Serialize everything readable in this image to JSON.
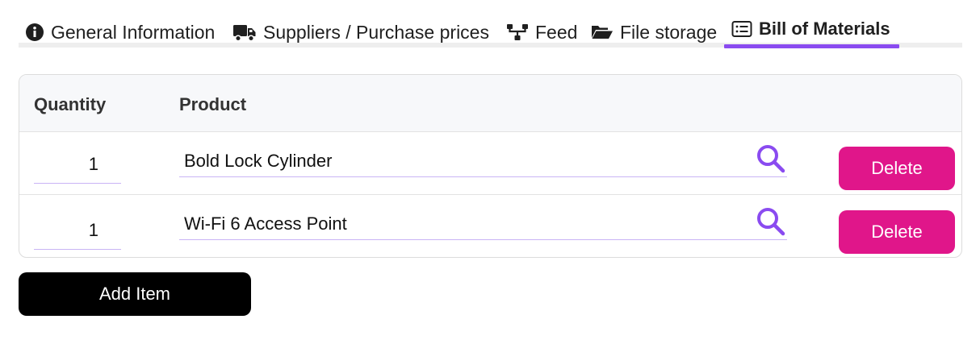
{
  "tabs": [
    {
      "label": "General Information",
      "icon": "info-circle-icon"
    },
    {
      "label": "Suppliers / Purchase prices",
      "icon": "truck-icon"
    },
    {
      "label": "Feed",
      "icon": "feed-nodes-icon"
    },
    {
      "label": "File storage",
      "icon": "folder-open-icon"
    },
    {
      "label": "Bill of Materials",
      "icon": "list-card-icon",
      "active": true
    }
  ],
  "table": {
    "headers": {
      "quantity": "Quantity",
      "product": "Product"
    },
    "rows": [
      {
        "quantity": "1",
        "product": "Bold Lock Cylinder",
        "delete_label": "Delete"
      },
      {
        "quantity": "1",
        "product": "Wi-Fi 6 Access Point",
        "delete_label": "Delete"
      }
    ]
  },
  "actions": {
    "add_item_label": "Add Item"
  },
  "colors": {
    "accent": "#8a4bf0",
    "delete": "#e0168a",
    "primary_button": "#000000"
  }
}
